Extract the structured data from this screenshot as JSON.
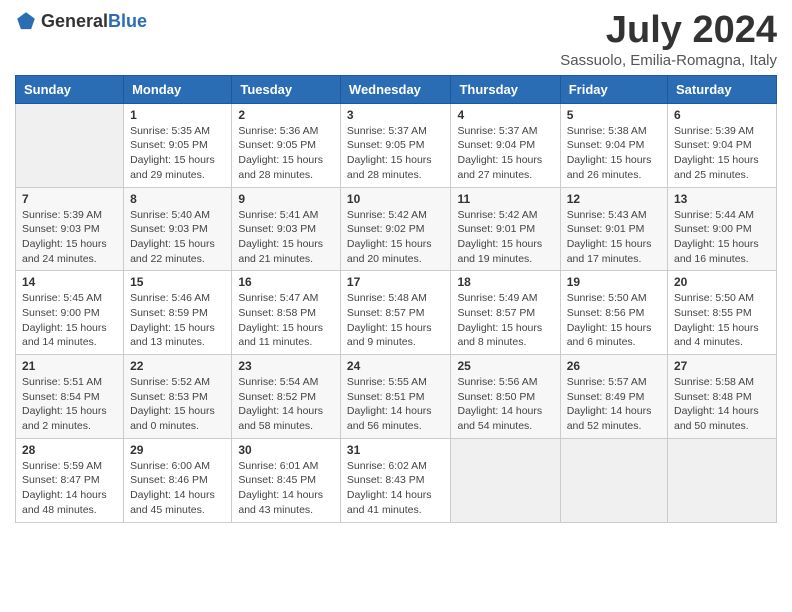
{
  "logo": {
    "text_general": "General",
    "text_blue": "Blue"
  },
  "title": "July 2024",
  "subtitle": "Sassuolo, Emilia-Romagna, Italy",
  "weekdays": [
    "Sunday",
    "Monday",
    "Tuesday",
    "Wednesday",
    "Thursday",
    "Friday",
    "Saturday"
  ],
  "weeks": [
    [
      {
        "day": "",
        "info": ""
      },
      {
        "day": "1",
        "info": "Sunrise: 5:35 AM\nSunset: 9:05 PM\nDaylight: 15 hours\nand 29 minutes."
      },
      {
        "day": "2",
        "info": "Sunrise: 5:36 AM\nSunset: 9:05 PM\nDaylight: 15 hours\nand 28 minutes."
      },
      {
        "day": "3",
        "info": "Sunrise: 5:37 AM\nSunset: 9:05 PM\nDaylight: 15 hours\nand 28 minutes."
      },
      {
        "day": "4",
        "info": "Sunrise: 5:37 AM\nSunset: 9:04 PM\nDaylight: 15 hours\nand 27 minutes."
      },
      {
        "day": "5",
        "info": "Sunrise: 5:38 AM\nSunset: 9:04 PM\nDaylight: 15 hours\nand 26 minutes."
      },
      {
        "day": "6",
        "info": "Sunrise: 5:39 AM\nSunset: 9:04 PM\nDaylight: 15 hours\nand 25 minutes."
      }
    ],
    [
      {
        "day": "7",
        "info": "Sunrise: 5:39 AM\nSunset: 9:03 PM\nDaylight: 15 hours\nand 24 minutes."
      },
      {
        "day": "8",
        "info": "Sunrise: 5:40 AM\nSunset: 9:03 PM\nDaylight: 15 hours\nand 22 minutes."
      },
      {
        "day": "9",
        "info": "Sunrise: 5:41 AM\nSunset: 9:03 PM\nDaylight: 15 hours\nand 21 minutes."
      },
      {
        "day": "10",
        "info": "Sunrise: 5:42 AM\nSunset: 9:02 PM\nDaylight: 15 hours\nand 20 minutes."
      },
      {
        "day": "11",
        "info": "Sunrise: 5:42 AM\nSunset: 9:01 PM\nDaylight: 15 hours\nand 19 minutes."
      },
      {
        "day": "12",
        "info": "Sunrise: 5:43 AM\nSunset: 9:01 PM\nDaylight: 15 hours\nand 17 minutes."
      },
      {
        "day": "13",
        "info": "Sunrise: 5:44 AM\nSunset: 9:00 PM\nDaylight: 15 hours\nand 16 minutes."
      }
    ],
    [
      {
        "day": "14",
        "info": "Sunrise: 5:45 AM\nSunset: 9:00 PM\nDaylight: 15 hours\nand 14 minutes."
      },
      {
        "day": "15",
        "info": "Sunrise: 5:46 AM\nSunset: 8:59 PM\nDaylight: 15 hours\nand 13 minutes."
      },
      {
        "day": "16",
        "info": "Sunrise: 5:47 AM\nSunset: 8:58 PM\nDaylight: 15 hours\nand 11 minutes."
      },
      {
        "day": "17",
        "info": "Sunrise: 5:48 AM\nSunset: 8:57 PM\nDaylight: 15 hours\nand 9 minutes."
      },
      {
        "day": "18",
        "info": "Sunrise: 5:49 AM\nSunset: 8:57 PM\nDaylight: 15 hours\nand 8 minutes."
      },
      {
        "day": "19",
        "info": "Sunrise: 5:50 AM\nSunset: 8:56 PM\nDaylight: 15 hours\nand 6 minutes."
      },
      {
        "day": "20",
        "info": "Sunrise: 5:50 AM\nSunset: 8:55 PM\nDaylight: 15 hours\nand 4 minutes."
      }
    ],
    [
      {
        "day": "21",
        "info": "Sunrise: 5:51 AM\nSunset: 8:54 PM\nDaylight: 15 hours\nand 2 minutes."
      },
      {
        "day": "22",
        "info": "Sunrise: 5:52 AM\nSunset: 8:53 PM\nDaylight: 15 hours\nand 0 minutes."
      },
      {
        "day": "23",
        "info": "Sunrise: 5:54 AM\nSunset: 8:52 PM\nDaylight: 14 hours\nand 58 minutes."
      },
      {
        "day": "24",
        "info": "Sunrise: 5:55 AM\nSunset: 8:51 PM\nDaylight: 14 hours\nand 56 minutes."
      },
      {
        "day": "25",
        "info": "Sunrise: 5:56 AM\nSunset: 8:50 PM\nDaylight: 14 hours\nand 54 minutes."
      },
      {
        "day": "26",
        "info": "Sunrise: 5:57 AM\nSunset: 8:49 PM\nDaylight: 14 hours\nand 52 minutes."
      },
      {
        "day": "27",
        "info": "Sunrise: 5:58 AM\nSunset: 8:48 PM\nDaylight: 14 hours\nand 50 minutes."
      }
    ],
    [
      {
        "day": "28",
        "info": "Sunrise: 5:59 AM\nSunset: 8:47 PM\nDaylight: 14 hours\nand 48 minutes."
      },
      {
        "day": "29",
        "info": "Sunrise: 6:00 AM\nSunset: 8:46 PM\nDaylight: 14 hours\nand 45 minutes."
      },
      {
        "day": "30",
        "info": "Sunrise: 6:01 AM\nSunset: 8:45 PM\nDaylight: 14 hours\nand 43 minutes."
      },
      {
        "day": "31",
        "info": "Sunrise: 6:02 AM\nSunset: 8:43 PM\nDaylight: 14 hours\nand 41 minutes."
      },
      {
        "day": "",
        "info": ""
      },
      {
        "day": "",
        "info": ""
      },
      {
        "day": "",
        "info": ""
      }
    ]
  ]
}
